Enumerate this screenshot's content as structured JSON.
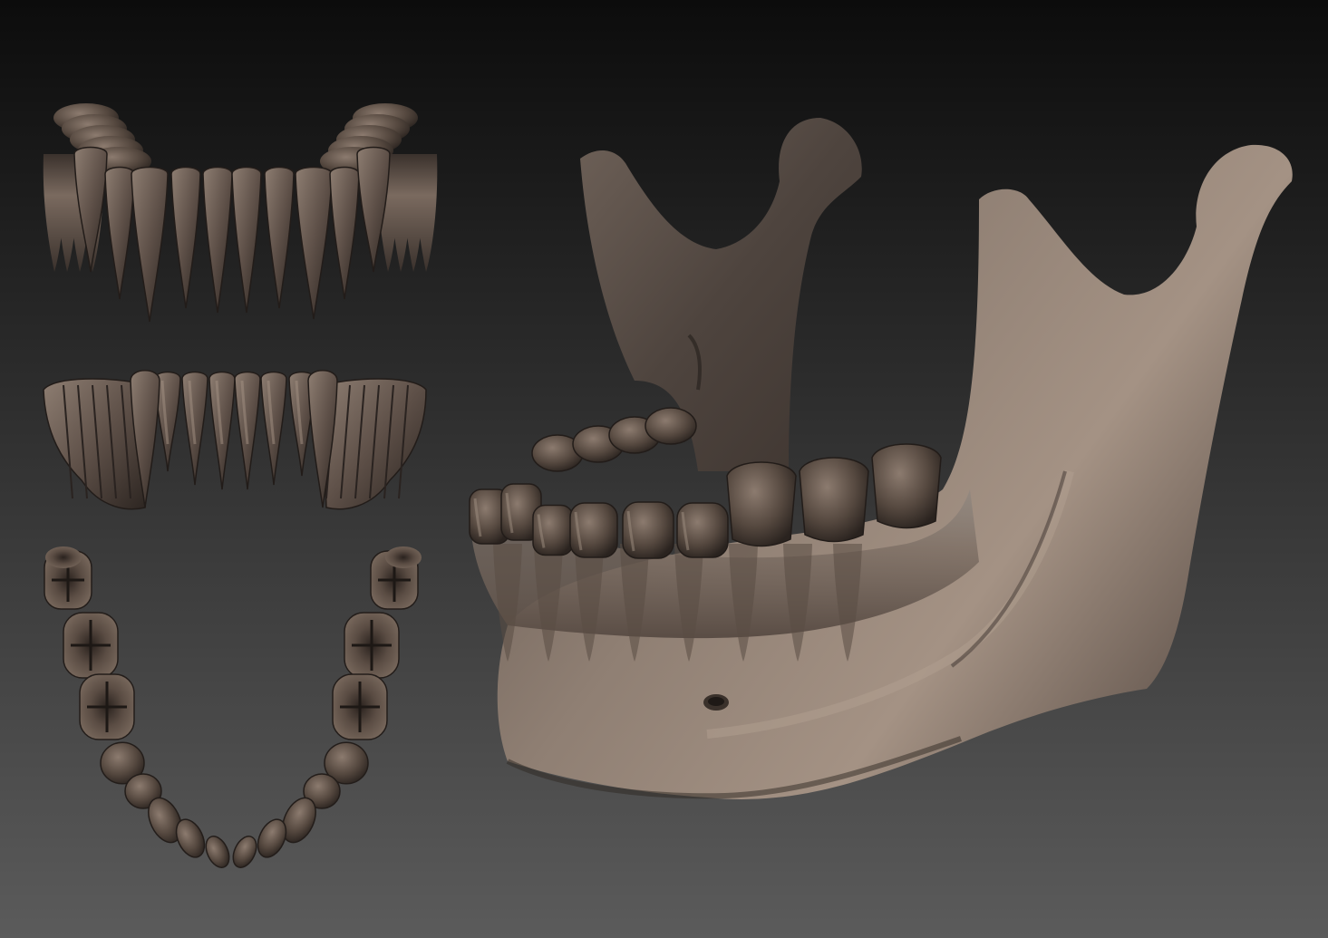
{
  "scene": {
    "background_top_color": "#0c0c0c",
    "background_bottom_color": "#5b5b5b",
    "material_light_color": "#9c8a7c",
    "material_mid_color": "#6e5f55",
    "material_dark_color": "#2e2622"
  },
  "panels": [
    {
      "name": "lower-teeth-back-view"
    },
    {
      "name": "lower-teeth-front-view"
    },
    {
      "name": "lower-teeth-occlusal-view"
    },
    {
      "name": "mandible-3d-view"
    }
  ]
}
